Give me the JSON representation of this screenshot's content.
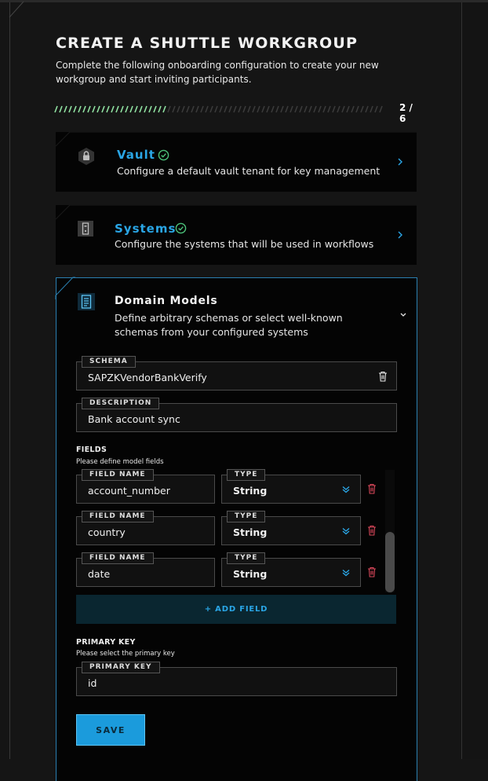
{
  "page": {
    "title": "CREATE A SHUTTLE WORKGROUP",
    "subtitle": "Complete the following onboarding configuration to create your new workgroup and start inviting participants.",
    "progress": {
      "current": 2,
      "total": 6,
      "label": "2 / 6"
    }
  },
  "steps": [
    {
      "title": "Vault",
      "description": "Configure a default vault tenant for key management",
      "completed": true,
      "icon": "lock-icon"
    },
    {
      "title": "Systems",
      "description": "Configure the systems that will be used in workflows",
      "completed": true,
      "icon": "server-icon"
    }
  ],
  "domain_models": {
    "title": "Domain Models",
    "description": "Define arbitrary schemas or select well-known schemas from your configured systems",
    "icon": "document-icon",
    "schema": {
      "label": "SCHEMA",
      "value": "SAPZKVendorBankVerify"
    },
    "description_field": {
      "label": "DESCRIPTION",
      "value": "Bank account sync"
    },
    "fields_section": {
      "label": "FIELDS",
      "hint": "Please define model fields"
    },
    "fields": [
      {
        "name_label": "FIELD NAME",
        "name": "account_number",
        "type_label": "TYPE",
        "type": "String"
      },
      {
        "name_label": "FIELD NAME",
        "name": "country",
        "type_label": "TYPE",
        "type": "String"
      },
      {
        "name_label": "FIELD NAME",
        "name": "date",
        "type_label": "TYPE",
        "type": "String"
      }
    ],
    "add_field_label": "+ ADD FIELD",
    "primary_key_section": {
      "label": "PRIMARY KEY",
      "hint": "Please select the primary key"
    },
    "primary_key": {
      "label": "PRIMARY KEY",
      "value": "id"
    },
    "save_label": "SAVE"
  },
  "colors": {
    "accent": "#2aa6e6",
    "success": "#4cc27a",
    "danger": "#d9475a",
    "background": "#151515",
    "card": "#040404"
  }
}
